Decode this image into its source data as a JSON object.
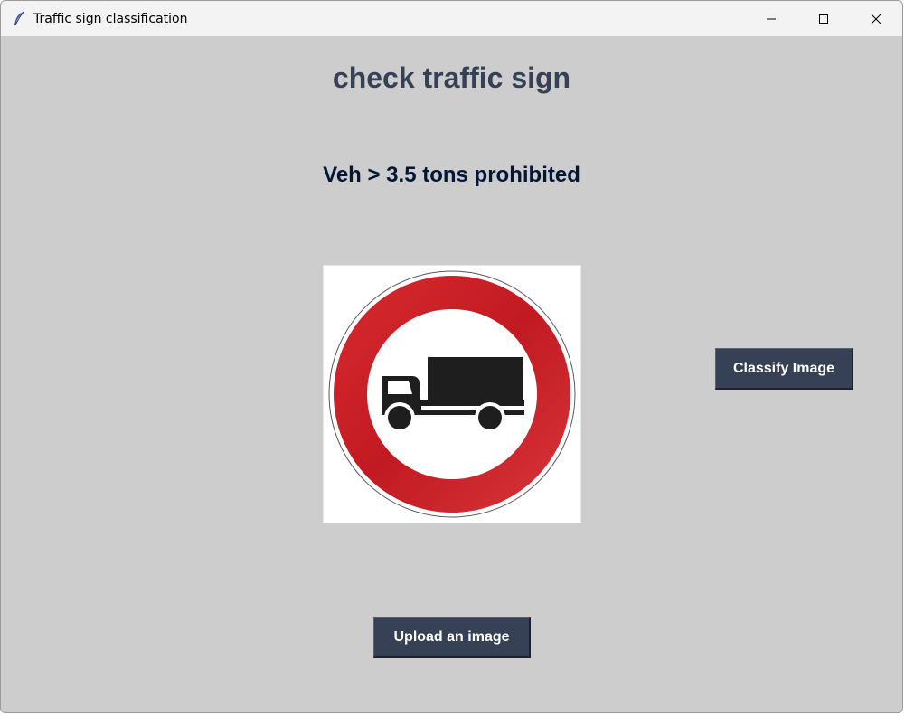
{
  "window": {
    "title": "Traffic sign classification",
    "controls": [
      "minimize",
      "maximize",
      "close"
    ]
  },
  "main": {
    "heading": "check traffic sign",
    "prediction": "Veh > 3.5 tons prohibited",
    "image": {
      "description_icon": "truck-prohibited-sign-icon"
    },
    "classify_button_label": "Classify Image",
    "upload_button_label": "Upload an image"
  },
  "colors": {
    "background": "#cdcdcd",
    "heading": "#364156",
    "prediction": "#011638",
    "button_bg": "#364156",
    "button_text": "#ffffff",
    "sign_red": "#c81e25"
  }
}
